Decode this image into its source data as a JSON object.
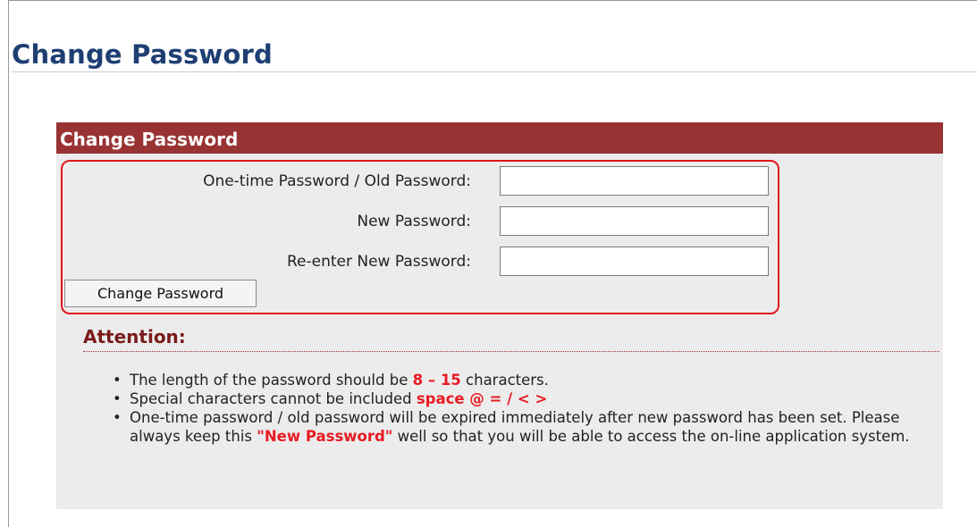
{
  "page": {
    "title": "Change Password"
  },
  "panel": {
    "header": "Change Password",
    "fields": [
      {
        "label": "One-time Password / Old Password:",
        "value": "",
        "placeholder": ""
      },
      {
        "label": "New Password:",
        "value": "",
        "placeholder": ""
      },
      {
        "label": "Re-enter New Password:",
        "value": "",
        "placeholder": ""
      }
    ],
    "submit_label": "Change Password",
    "highlight_color": "#e81b23",
    "header_color": "#993333"
  },
  "attention": {
    "title": "Attention:",
    "notes": {
      "length_pre": "The length of the password should be ",
      "length_range": "8 – 15",
      "length_post": " characters.",
      "special_pre": "Special characters cannot be included ",
      "special_chars": "space @ = / < >",
      "expire_pre": "One-time password / old password will be expired immediately after new password has been set. Please always keep this ",
      "expire_highlight": "\"New Password\"",
      "expire_post": " well so that you will be able to access the on-line application system."
    }
  }
}
